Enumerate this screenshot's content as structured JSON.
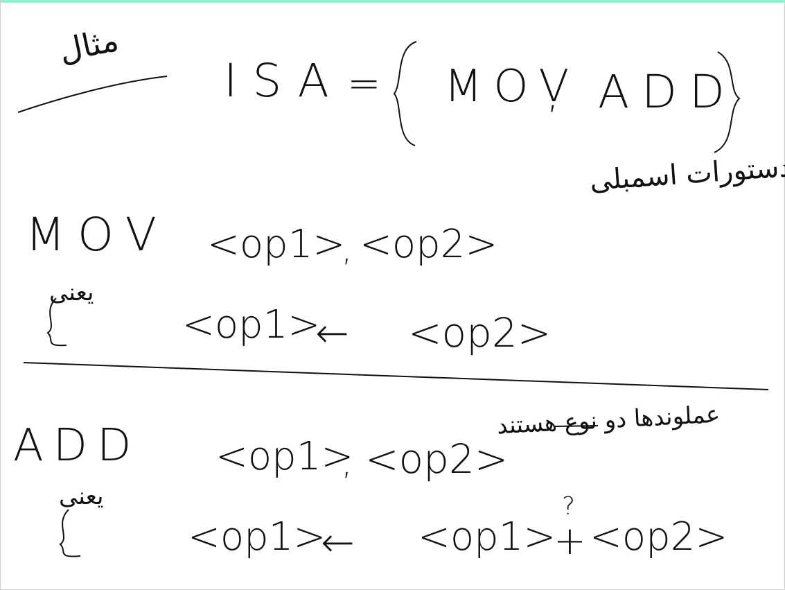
{
  "colors": {
    "ink": "#111111",
    "top_strip": "#8ff0d3",
    "page": "#ffffff"
  },
  "heading": {
    "example_label": "مثال"
  },
  "isa_definition": {
    "lhs": "ISA",
    "equals": "=",
    "open_brace": "{",
    "instructions": [
      "MOV",
      "ADD"
    ],
    "separator": ",",
    "close_brace": "}",
    "caption": "دستورات اسمبلی"
  },
  "mov_section": {
    "mnemonic": "MOV",
    "operand1": "<op1>",
    "comma": ",",
    "operand2": "<op2>",
    "meaning_label": "یعنی",
    "meaning_lhs": "<op1>",
    "meaning_arrow": "←",
    "meaning_rhs": "<op2>"
  },
  "add_section": {
    "note": "عملوندها دو نوع هستند",
    "mnemonic": "ADD",
    "operand1": "<op1>",
    "comma": ",",
    "operand2": "<op2>",
    "meaning_label": "یعنی",
    "meaning_lhs": "<op1>",
    "meaning_arrow": "←",
    "meaning_rhs_a": "<op1>",
    "question_mark": "?",
    "plus": "+",
    "meaning_rhs_b": "<op2>"
  }
}
